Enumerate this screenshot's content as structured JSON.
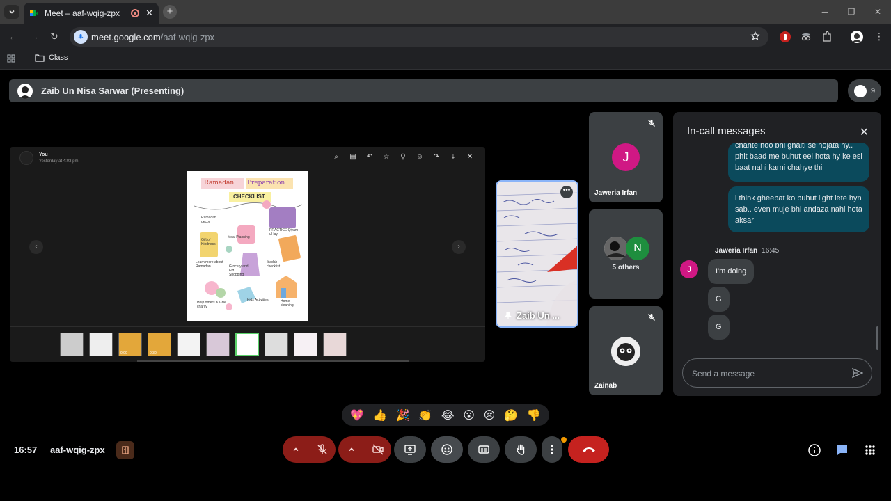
{
  "browser": {
    "tab_title": "Meet – aaf-wqig-zpx",
    "url_domain": "meet.google.com",
    "url_path": "/aaf-wqig-zpx",
    "bookmark_folder": "Class"
  },
  "meet": {
    "presenting_label": "Zaib Un Nisa Sarwar (Presenting)",
    "participant_count": "9",
    "viewer": {
      "sender": "You",
      "timestamp": "Yesterday at 4:03 pm"
    },
    "poster": {
      "title_a": "Ramadan",
      "title_b": "Preparation",
      "title_c": "CHECKLIST",
      "items": [
        "Ramadan decor",
        "Meal Planning",
        "PRACTICE Qiyam-ul-layl",
        "Gift of Kindness",
        "Learn more about Ramadan",
        "Grocery and Eid Shopping",
        "Ibadah checklist",
        "Help others & Give charity",
        "Kids Activities",
        "Home cleaning"
      ]
    },
    "thumbs": [
      {
        "kind": "doc",
        "label": ""
      },
      {
        "kind": "doc",
        "label": ""
      },
      {
        "kind": "image",
        "label": "0:00"
      },
      {
        "kind": "image",
        "label": "0:30"
      },
      {
        "kind": "doc",
        "label": ""
      },
      {
        "kind": "doc",
        "label": ""
      },
      {
        "kind": "selected",
        "label": ""
      },
      {
        "kind": "doc",
        "label": ""
      },
      {
        "kind": "doc",
        "label": ""
      },
      {
        "kind": "doc",
        "label": ""
      }
    ],
    "presenter_tile": "Zaib Un ...",
    "tiles": [
      {
        "name": "Jaweria Irfan",
        "initial": "J"
      },
      {
        "name": "5 others",
        "initial": "N"
      },
      {
        "name": "Zainab",
        "initial": ""
      }
    ],
    "clock": "16:57",
    "meeting_code": "aaf-wqig-zpx",
    "reactions": [
      "💖",
      "👍",
      "🎉",
      "👏",
      "😂",
      "😮",
      "😢",
      "🤔",
      "👎"
    ]
  },
  "chat": {
    "title": "In-call messages",
    "messages_out": [
      "chahte hoo bhi ghalti se hojata hy.. phit baad me buhut eel hota hy ke esi baat nahi karni chahye thi",
      "i think gheebat ko buhut light lete hyn sab.. even muje bhi andaza nahi hota aksar"
    ],
    "sender": "Jaweria Irfan",
    "sender_initial": "J",
    "time": "16:45",
    "messages_in": [
      "I'm doing",
      "G",
      "G"
    ],
    "input_placeholder": "Send a message"
  },
  "colors": {
    "accent_blue": "#8ab4f8",
    "end_call_red": "#c5221f",
    "muted_red": "#8c1d18",
    "chat_bubble_out": "#0b4a5c",
    "avatar_pink": "#d01884",
    "avatar_green": "#1e8e3e"
  }
}
